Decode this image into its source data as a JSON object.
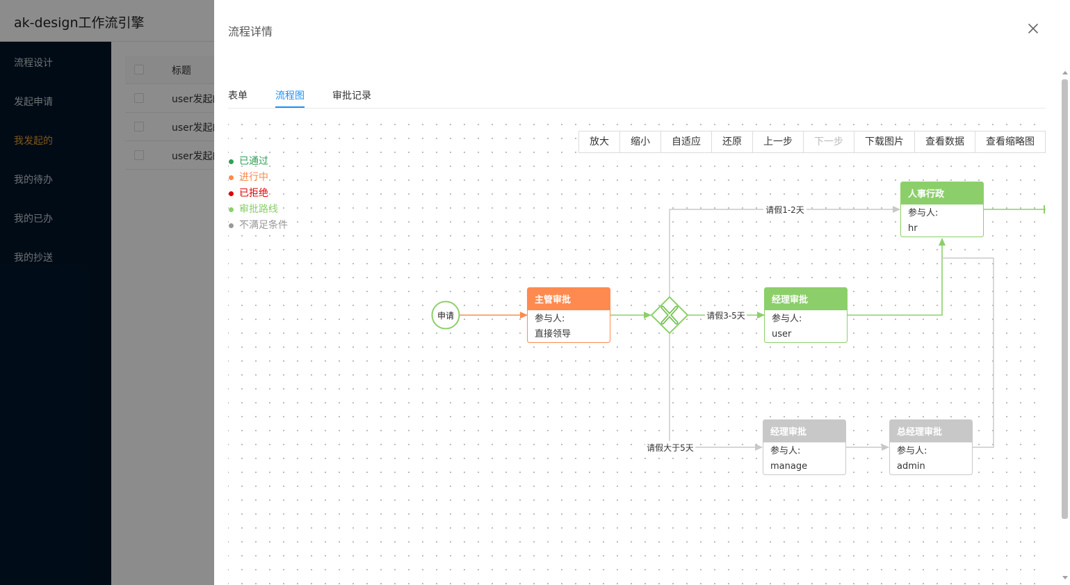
{
  "app": {
    "title": "ak-design工作流引擎",
    "sidebar": [
      {
        "label": "流程设计"
      },
      {
        "label": "发起申请"
      },
      {
        "label": "我发起的",
        "active": true
      },
      {
        "label": "我的待办"
      },
      {
        "label": "我的已办"
      },
      {
        "label": "我的抄送"
      }
    ],
    "table": {
      "header": "标题",
      "rows": [
        "user发起的",
        "user发起的",
        "user发起的"
      ]
    }
  },
  "drawer": {
    "title": "流程详情",
    "close_icon": "close-icon",
    "tabs": [
      {
        "label": "表单"
      },
      {
        "label": "流程图",
        "active": true
      },
      {
        "label": "审批记录"
      }
    ],
    "toolbar": [
      {
        "label": "放大",
        "enabled": true
      },
      {
        "label": "缩小",
        "enabled": true
      },
      {
        "label": "自适应",
        "enabled": true
      },
      {
        "label": "还原",
        "enabled": true
      },
      {
        "label": "上一步",
        "enabled": true
      },
      {
        "label": "下一步",
        "enabled": false
      },
      {
        "label": "下载图片",
        "enabled": true
      },
      {
        "label": "查看数据",
        "enabled": true
      },
      {
        "label": "查看缩略图",
        "enabled": true
      }
    ],
    "legend": [
      {
        "label": "已通过",
        "color": "#2f9e58"
      },
      {
        "label": "进行中",
        "color": "#ff8a4f"
      },
      {
        "label": "已拒绝",
        "color": "#e00000"
      },
      {
        "label": "审批路线",
        "color": "#8ccf6a"
      },
      {
        "label": "不满足条件",
        "color": "#999999"
      }
    ]
  },
  "flow": {
    "colors": {
      "orange": "#ff8a4f",
      "green": "#8ccf6a",
      "gray": "#c8c8c8",
      "gateway_icon": "#6fbf4a"
    },
    "start": {
      "label": "申请"
    },
    "gateway_icon": "exclusive-gateway-x-icon",
    "participant_label": "参与人:",
    "nodes": {
      "supervisor": {
        "title": "主管审批",
        "participant": "直接领导",
        "status": "in-progress"
      },
      "manager": {
        "title": "经理审批",
        "participant": "user",
        "status": "route"
      },
      "hr": {
        "title": "人事行政",
        "participant": "hr",
        "status": "route"
      },
      "manager2": {
        "title": "经理审批",
        "participant": "manage",
        "status": "unmet"
      },
      "gm": {
        "title": "总经理审批",
        "participant": "admin",
        "status": "unmet"
      }
    },
    "edges": {
      "cond_short": "请假1-2天",
      "cond_mid": "请假3-5天",
      "cond_long": "请假大于5天"
    }
  }
}
